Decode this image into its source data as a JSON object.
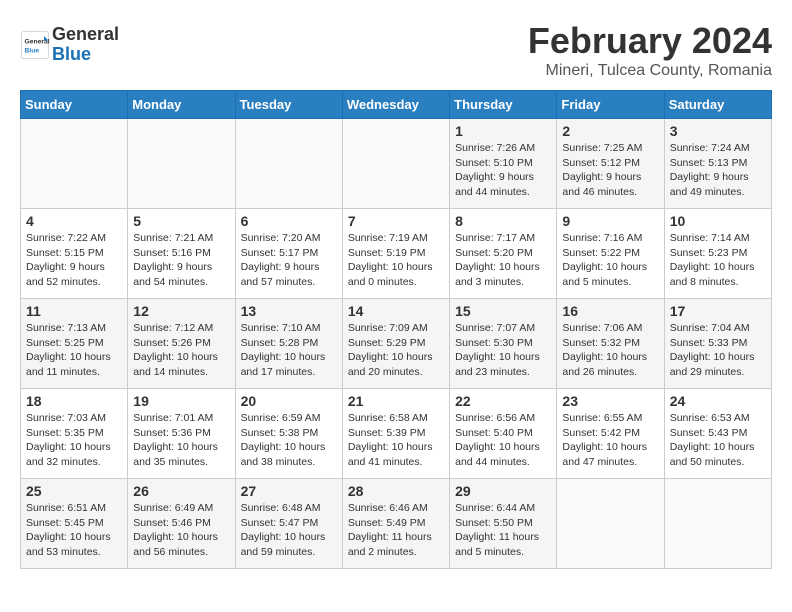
{
  "logo": {
    "general": "General",
    "blue": "Blue"
  },
  "title": "February 2024",
  "subtitle": "Mineri, Tulcea County, Romania",
  "weekdays": [
    "Sunday",
    "Monday",
    "Tuesday",
    "Wednesday",
    "Thursday",
    "Friday",
    "Saturday"
  ],
  "weeks": [
    [
      {
        "day": "",
        "info": ""
      },
      {
        "day": "",
        "info": ""
      },
      {
        "day": "",
        "info": ""
      },
      {
        "day": "",
        "info": ""
      },
      {
        "day": "1",
        "info": "Sunrise: 7:26 AM\nSunset: 5:10 PM\nDaylight: 9 hours\nand 44 minutes."
      },
      {
        "day": "2",
        "info": "Sunrise: 7:25 AM\nSunset: 5:12 PM\nDaylight: 9 hours\nand 46 minutes."
      },
      {
        "day": "3",
        "info": "Sunrise: 7:24 AM\nSunset: 5:13 PM\nDaylight: 9 hours\nand 49 minutes."
      }
    ],
    [
      {
        "day": "4",
        "info": "Sunrise: 7:22 AM\nSunset: 5:15 PM\nDaylight: 9 hours\nand 52 minutes."
      },
      {
        "day": "5",
        "info": "Sunrise: 7:21 AM\nSunset: 5:16 PM\nDaylight: 9 hours\nand 54 minutes."
      },
      {
        "day": "6",
        "info": "Sunrise: 7:20 AM\nSunset: 5:17 PM\nDaylight: 9 hours\nand 57 minutes."
      },
      {
        "day": "7",
        "info": "Sunrise: 7:19 AM\nSunset: 5:19 PM\nDaylight: 10 hours\nand 0 minutes."
      },
      {
        "day": "8",
        "info": "Sunrise: 7:17 AM\nSunset: 5:20 PM\nDaylight: 10 hours\nand 3 minutes."
      },
      {
        "day": "9",
        "info": "Sunrise: 7:16 AM\nSunset: 5:22 PM\nDaylight: 10 hours\nand 5 minutes."
      },
      {
        "day": "10",
        "info": "Sunrise: 7:14 AM\nSunset: 5:23 PM\nDaylight: 10 hours\nand 8 minutes."
      }
    ],
    [
      {
        "day": "11",
        "info": "Sunrise: 7:13 AM\nSunset: 5:25 PM\nDaylight: 10 hours\nand 11 minutes."
      },
      {
        "day": "12",
        "info": "Sunrise: 7:12 AM\nSunset: 5:26 PM\nDaylight: 10 hours\nand 14 minutes."
      },
      {
        "day": "13",
        "info": "Sunrise: 7:10 AM\nSunset: 5:28 PM\nDaylight: 10 hours\nand 17 minutes."
      },
      {
        "day": "14",
        "info": "Sunrise: 7:09 AM\nSunset: 5:29 PM\nDaylight: 10 hours\nand 20 minutes."
      },
      {
        "day": "15",
        "info": "Sunrise: 7:07 AM\nSunset: 5:30 PM\nDaylight: 10 hours\nand 23 minutes."
      },
      {
        "day": "16",
        "info": "Sunrise: 7:06 AM\nSunset: 5:32 PM\nDaylight: 10 hours\nand 26 minutes."
      },
      {
        "day": "17",
        "info": "Sunrise: 7:04 AM\nSunset: 5:33 PM\nDaylight: 10 hours\nand 29 minutes."
      }
    ],
    [
      {
        "day": "18",
        "info": "Sunrise: 7:03 AM\nSunset: 5:35 PM\nDaylight: 10 hours\nand 32 minutes."
      },
      {
        "day": "19",
        "info": "Sunrise: 7:01 AM\nSunset: 5:36 PM\nDaylight: 10 hours\nand 35 minutes."
      },
      {
        "day": "20",
        "info": "Sunrise: 6:59 AM\nSunset: 5:38 PM\nDaylight: 10 hours\nand 38 minutes."
      },
      {
        "day": "21",
        "info": "Sunrise: 6:58 AM\nSunset: 5:39 PM\nDaylight: 10 hours\nand 41 minutes."
      },
      {
        "day": "22",
        "info": "Sunrise: 6:56 AM\nSunset: 5:40 PM\nDaylight: 10 hours\nand 44 minutes."
      },
      {
        "day": "23",
        "info": "Sunrise: 6:55 AM\nSunset: 5:42 PM\nDaylight: 10 hours\nand 47 minutes."
      },
      {
        "day": "24",
        "info": "Sunrise: 6:53 AM\nSunset: 5:43 PM\nDaylight: 10 hours\nand 50 minutes."
      }
    ],
    [
      {
        "day": "25",
        "info": "Sunrise: 6:51 AM\nSunset: 5:45 PM\nDaylight: 10 hours\nand 53 minutes."
      },
      {
        "day": "26",
        "info": "Sunrise: 6:49 AM\nSunset: 5:46 PM\nDaylight: 10 hours\nand 56 minutes."
      },
      {
        "day": "27",
        "info": "Sunrise: 6:48 AM\nSunset: 5:47 PM\nDaylight: 10 hours\nand 59 minutes."
      },
      {
        "day": "28",
        "info": "Sunrise: 6:46 AM\nSunset: 5:49 PM\nDaylight: 11 hours\nand 2 minutes."
      },
      {
        "day": "29",
        "info": "Sunrise: 6:44 AM\nSunset: 5:50 PM\nDaylight: 11 hours\nand 5 minutes."
      },
      {
        "day": "",
        "info": ""
      },
      {
        "day": "",
        "info": ""
      }
    ]
  ]
}
